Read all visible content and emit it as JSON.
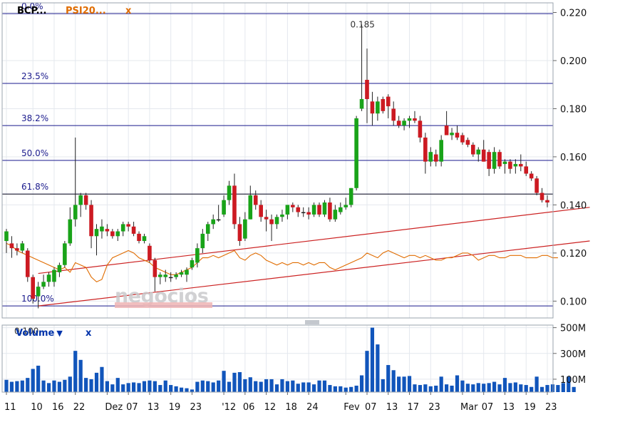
{
  "header": {
    "symbol": "BCP...",
    "comparison": "PSI20...",
    "remove_comparison": "x"
  },
  "volume_header": {
    "label": "Volume",
    "dropdown_glyph": "▼",
    "remove": "x"
  },
  "watermark": "negocios",
  "colors": {
    "up": "#19a319",
    "down": "#cc1a22",
    "fib": "#1a1a8c",
    "trend": "#cc2222",
    "comparison": "#e06c00",
    "volume": "#1155bb",
    "grid": "#e4e8ee"
  },
  "chart_data": [
    {
      "type": "candlestick",
      "ylim": [
        0.093,
        0.224
      ],
      "y_ticks": [
        "0.220",
        "0.200",
        "0.180",
        "0.160",
        "0.140",
        "0.120",
        "0.100"
      ],
      "x_ticks": [
        "11",
        "10",
        "16",
        "22",
        "Dez",
        "07",
        "13",
        "19",
        "23",
        "'12",
        "06",
        "12",
        "18",
        "24",
        "Fev",
        "07",
        "13",
        "17",
        "23",
        "Mar",
        "07",
        "13",
        "19",
        "23"
      ],
      "x_tick_index": [
        0,
        5,
        9,
        13,
        19,
        23,
        27,
        31,
        35,
        41,
        45,
        49,
        53,
        57,
        64,
        68,
        72,
        76,
        80,
        86,
        90,
        94,
        98,
        102
      ],
      "annotations": {
        "high_label": "0.185",
        "low_label": "0.100"
      },
      "fib_levels": [
        {
          "label": "0.0%",
          "value": 0.2195
        },
        {
          "label": "23.5%",
          "value": 0.1905
        },
        {
          "label": "38.2%",
          "value": 0.173
        },
        {
          "label": "50.0%",
          "value": 0.1585
        },
        {
          "label": "61.8%",
          "value": 0.1445
        },
        {
          "label": "100.0%",
          "value": 0.098
        }
      ],
      "reference_line": 0.1445,
      "trendlines": [
        {
          "x": [
            6,
            110
          ],
          "y": [
            0.1115,
            0.139
          ]
        },
        {
          "x": [
            6,
            110
          ],
          "y": [
            0.098,
            0.125
          ]
        }
      ],
      "ohlc": [
        [
          0.125,
          0.13,
          0.12,
          0.129
        ],
        [
          0.124,
          0.127,
          0.118,
          0.122
        ],
        [
          0.122,
          0.124,
          0.119,
          0.121
        ],
        [
          0.121,
          0.125,
          0.12,
          0.124
        ],
        [
          0.121,
          0.122,
          0.108,
          0.11
        ],
        [
          0.11,
          0.111,
          0.099,
          0.101
        ],
        [
          0.102,
          0.108,
          0.097,
          0.106
        ],
        [
          0.106,
          0.111,
          0.105,
          0.108
        ],
        [
          0.108,
          0.112,
          0.106,
          0.111
        ],
        [
          0.108,
          0.114,
          0.106,
          0.113
        ],
        [
          0.112,
          0.116,
          0.11,
          0.115
        ],
        [
          0.115,
          0.125,
          0.114,
          0.124
        ],
        [
          0.124,
          0.139,
          0.123,
          0.134
        ],
        [
          0.134,
          0.168,
          0.131,
          0.14
        ],
        [
          0.14,
          0.145,
          0.135,
          0.144
        ],
        [
          0.144,
          0.145,
          0.138,
          0.14
        ],
        [
          0.14,
          0.142,
          0.122,
          0.127
        ],
        [
          0.127,
          0.132,
          0.119,
          0.13
        ],
        [
          0.129,
          0.134,
          0.126,
          0.131
        ],
        [
          0.13,
          0.132,
          0.127,
          0.129
        ],
        [
          0.129,
          0.13,
          0.126,
          0.127
        ],
        [
          0.127,
          0.13,
          0.125,
          0.129
        ],
        [
          0.129,
          0.133,
          0.127,
          0.132
        ],
        [
          0.132,
          0.133,
          0.129,
          0.131
        ],
        [
          0.131,
          0.133,
          0.127,
          0.128
        ],
        [
          0.128,
          0.129,
          0.124,
          0.125
        ],
        [
          0.125,
          0.128,
          0.124,
          0.127
        ],
        [
          0.123,
          0.124,
          0.116,
          0.117
        ],
        [
          0.117,
          0.118,
          0.104,
          0.11
        ],
        [
          0.11,
          0.112,
          0.107,
          0.111
        ],
        [
          0.11,
          0.113,
          0.108,
          0.111
        ],
        [
          0.11,
          0.112,
          0.108,
          0.11
        ],
        [
          0.11,
          0.112,
          0.109,
          0.111
        ],
        [
          0.111,
          0.113,
          0.11,
          0.112
        ],
        [
          0.111,
          0.114,
          0.108,
          0.113
        ],
        [
          0.114,
          0.118,
          0.113,
          0.117
        ],
        [
          0.116,
          0.124,
          0.114,
          0.122
        ],
        [
          0.122,
          0.13,
          0.12,
          0.128
        ],
        [
          0.128,
          0.133,
          0.125,
          0.132
        ],
        [
          0.132,
          0.136,
          0.13,
          0.134
        ],
        [
          0.134,
          0.14,
          0.133,
          0.134
        ],
        [
          0.136,
          0.144,
          0.135,
          0.142
        ],
        [
          0.142,
          0.15,
          0.14,
          0.148
        ],
        [
          0.148,
          0.153,
          0.13,
          0.132
        ],
        [
          0.132,
          0.135,
          0.123,
          0.125
        ],
        [
          0.126,
          0.137,
          0.125,
          0.134
        ],
        [
          0.134,
          0.148,
          0.134,
          0.144
        ],
        [
          0.144,
          0.146,
          0.138,
          0.14
        ],
        [
          0.14,
          0.142,
          0.133,
          0.135
        ],
        [
          0.135,
          0.138,
          0.129,
          0.134
        ],
        [
          0.134,
          0.136,
          0.125,
          0.132
        ],
        [
          0.132,
          0.136,
          0.13,
          0.135
        ],
        [
          0.135,
          0.138,
          0.133,
          0.136
        ],
        [
          0.136,
          0.14,
          0.134,
          0.14
        ],
        [
          0.14,
          0.141,
          0.137,
          0.139
        ],
        [
          0.139,
          0.14,
          0.135,
          0.137
        ],
        [
          0.137,
          0.139,
          0.135,
          0.137
        ],
        [
          0.137,
          0.139,
          0.134,
          0.136
        ],
        [
          0.136,
          0.141,
          0.135,
          0.14
        ],
        [
          0.14,
          0.141,
          0.135,
          0.136
        ],
        [
          0.136,
          0.142,
          0.135,
          0.141
        ],
        [
          0.141,
          0.143,
          0.133,
          0.134
        ],
        [
          0.134,
          0.14,
          0.133,
          0.138
        ],
        [
          0.137,
          0.141,
          0.136,
          0.139
        ],
        [
          0.139,
          0.143,
          0.138,
          0.14
        ],
        [
          0.14,
          0.147,
          0.139,
          0.147
        ],
        [
          0.147,
          0.177,
          0.146,
          0.176
        ],
        [
          0.18,
          0.215,
          0.179,
          0.184
        ],
        [
          0.192,
          0.205,
          0.174,
          0.184
        ],
        [
          0.183,
          0.187,
          0.173,
          0.178
        ],
        [
          0.178,
          0.185,
          0.175,
          0.183
        ],
        [
          0.184,
          0.185,
          0.178,
          0.179
        ],
        [
          0.185,
          0.186,
          0.176,
          0.181
        ],
        [
          0.18,
          0.183,
          0.173,
          0.175
        ],
        [
          0.175,
          0.177,
          0.172,
          0.173
        ],
        [
          0.173,
          0.176,
          0.171,
          0.175
        ],
        [
          0.175,
          0.177,
          0.172,
          0.176
        ],
        [
          0.176,
          0.179,
          0.174,
          0.175
        ],
        [
          0.175,
          0.177,
          0.166,
          0.168
        ],
        [
          0.168,
          0.17,
          0.153,
          0.158
        ],
        [
          0.158,
          0.164,
          0.156,
          0.162
        ],
        [
          0.161,
          0.163,
          0.156,
          0.158
        ],
        [
          0.158,
          0.169,
          0.156,
          0.167
        ],
        [
          0.173,
          0.179,
          0.172,
          0.169
        ],
        [
          0.169,
          0.172,
          0.167,
          0.17
        ],
        [
          0.17,
          0.173,
          0.167,
          0.168
        ],
        [
          0.169,
          0.17,
          0.165,
          0.166
        ],
        [
          0.167,
          0.168,
          0.164,
          0.165
        ],
        [
          0.165,
          0.166,
          0.16,
          0.161
        ],
        [
          0.161,
          0.164,
          0.158,
          0.163
        ],
        [
          0.163,
          0.167,
          0.158,
          0.158
        ],
        [
          0.162,
          0.163,
          0.152,
          0.155
        ],
        [
          0.155,
          0.164,
          0.153,
          0.162
        ],
        [
          0.162,
          0.163,
          0.155,
          0.156
        ],
        [
          0.157,
          0.159,
          0.153,
          0.158
        ],
        [
          0.158,
          0.159,
          0.153,
          0.155
        ],
        [
          0.156,
          0.159,
          0.153,
          0.157
        ],
        [
          0.157,
          0.161,
          0.154,
          0.156
        ],
        [
          0.156,
          0.158,
          0.152,
          0.153
        ],
        [
          0.153,
          0.154,
          0.15,
          0.151
        ],
        [
          0.151,
          0.152,
          0.144,
          0.145
        ],
        [
          0.145,
          0.147,
          0.141,
          0.142
        ],
        [
          0.142,
          0.144,
          0.139,
          0.141
        ]
      ],
      "comparison": [
        0.124,
        0.123,
        0.121,
        0.12,
        0.119,
        0.118,
        0.117,
        0.116,
        0.115,
        0.114,
        0.113,
        0.114,
        0.112,
        0.116,
        0.115,
        0.114,
        0.11,
        0.108,
        0.109,
        0.115,
        0.118,
        0.119,
        0.12,
        0.121,
        0.12,
        0.118,
        0.117,
        0.116,
        0.114,
        0.113,
        0.112,
        0.111,
        0.111,
        0.112,
        0.113,
        0.114,
        0.116,
        0.118,
        0.118,
        0.119,
        0.118,
        0.119,
        0.12,
        0.121,
        0.118,
        0.117,
        0.119,
        0.12,
        0.119,
        0.117,
        0.116,
        0.115,
        0.116,
        0.115,
        0.116,
        0.116,
        0.115,
        0.116,
        0.115,
        0.116,
        0.116,
        0.114,
        0.113,
        0.114,
        0.115,
        0.116,
        0.117,
        0.118,
        0.12,
        0.119,
        0.118,
        0.12,
        0.121,
        0.12,
        0.119,
        0.118,
        0.119,
        0.119,
        0.118,
        0.119,
        0.118,
        0.117,
        0.117,
        0.118,
        0.118,
        0.119,
        0.12,
        0.12,
        0.119,
        0.117,
        0.118,
        0.119,
        0.119,
        0.118,
        0.118,
        0.119,
        0.119,
        0.119,
        0.118,
        0.118,
        0.118,
        0.119,
        0.119,
        0.118,
        0.118
      ],
      "volume": {
        "ylim": [
          0,
          520
        ],
        "y_ticks": [
          "500M",
          "300M",
          "100M"
        ],
        "y_tick_values": [
          500,
          300,
          100
        ],
        "values": [
          95,
          80,
          85,
          90,
          110,
          180,
          205,
          90,
          70,
          90,
          80,
          95,
          120,
          320,
          250,
          110,
          100,
          150,
          195,
          85,
          60,
          110,
          60,
          70,
          75,
          70,
          85,
          90,
          85,
          55,
          90,
          55,
          45,
          35,
          30,
          20,
          80,
          90,
          85,
          75,
          90,
          165,
          80,
          150,
          155,
          100,
          115,
          85,
          80,
          100,
          100,
          60,
          100,
          85,
          90,
          65,
          75,
          75,
          60,
          90,
          90,
          55,
          45,
          45,
          35,
          40,
          50,
          130,
          320,
          500,
          370,
          100,
          210,
          170,
          120,
          120,
          125,
          60,
          55,
          60,
          45,
          50,
          120,
          60,
          50,
          130,
          90,
          65,
          60,
          70,
          65,
          70,
          80,
          60,
          110,
          70,
          75,
          60,
          55,
          40,
          120,
          40,
          55,
          60,
          55,
          70,
          120,
          40
        ]
      }
    }
  ]
}
